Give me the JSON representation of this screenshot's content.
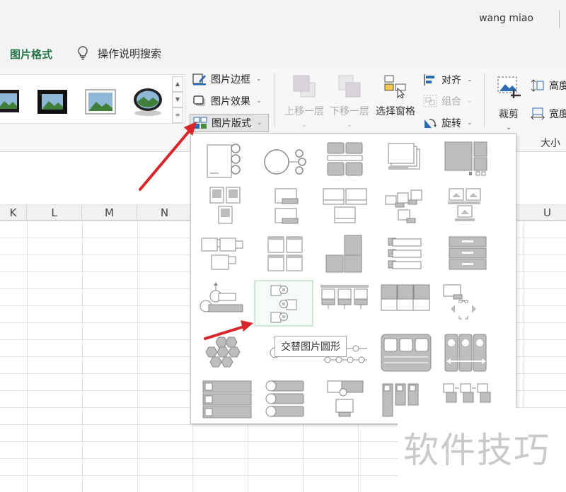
{
  "header": {
    "username": "wang miao",
    "tab_picture_format": "图片格式",
    "tell_me": "操作说明搜索"
  },
  "ribbon": {
    "picture_border": "图片边框",
    "picture_effects": "图片效果",
    "picture_layout": "图片版式",
    "bring_forward": "上移一层",
    "send_backward": "下移一层",
    "selection_pane": "选择窗格",
    "align": "对齐",
    "group": "组合",
    "rotate": "旋转",
    "crop": "裁剪",
    "height": "高度",
    "width": "宽度",
    "size_group": "大小"
  },
  "sheet": {
    "columns": [
      "K",
      "L",
      "M",
      "N",
      "U"
    ]
  },
  "layout_panel": {
    "tooltip": "交替图片圆形",
    "hovered_index": 16
  },
  "watermark": "软件技巧",
  "colors": {
    "accent_green": "#217346",
    "arrow_red": "#d9262b",
    "hover_border": "#cfe8d6"
  }
}
